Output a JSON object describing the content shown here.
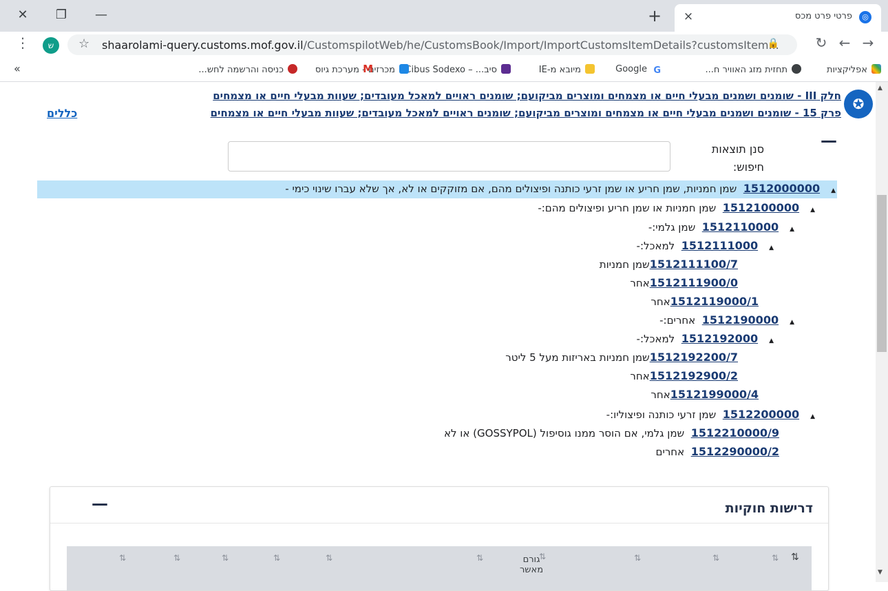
{
  "browser": {
    "tab_title": "פרטי פרט מכס",
    "tab_close": "×",
    "new_tab": "+",
    "window_close": "✕",
    "window_restore": "❐",
    "window_minimize": "—",
    "url_host": "shaarolami-query.customs.mof.gov.il",
    "url_path": "/CustomspilotWeb/he/CustomsBook/Import/ImportCustomsItemDetails?customsItem...",
    "avatar_letter": "ש",
    "bookmarks": [
      "אפליקציות",
      "תחזית מזג האוויר ח...",
      "Google",
      "מיובא מ-IE",
      "סיב... – Cibus Sodexo",
      "מכרזים - מערכת גיוס",
      "כניסה והרשמה לחש..."
    ],
    "bookmarks_overflow": "»"
  },
  "page": {
    "breadcrumb_1": "חלק III - שומנים ושמנים מבעלי חיים או מצמחים ומוצרים מביקועם; שומנים ראויים למאכל מעובדים; שעוות מבעלי חיים או מצמחים",
    "breadcrumb_2": "פרק 15 - שומנים ושמנים מבעלי חיים או מצמחים ומוצרים מביקועם; שומנים ראויים למאכל מעובדים; שעוות מבעלי חיים או מצמחים",
    "rules_link": "כללים",
    "filter_label": "סנן תוצאות חיפוש:",
    "collapse": "—",
    "tree": [
      {
        "code": "1512000000",
        "desc": "שמן חמניות, שמן חריע או שמן זרעי כותנה ופיצולים מהם, אם מזוקקים או לא, אך שלא עברו שינוי כימי -"
      },
      {
        "code": "1512100000",
        "desc": "שמן חמניות או שמן חריע ופיצולים מהם:-"
      },
      {
        "code": "1512110000",
        "desc": "שמן גלמי:-"
      },
      {
        "code": "1512111000",
        "desc": "למאכל:-"
      },
      {
        "code": "1512111100/7",
        "desc": "שמן חמניות"
      },
      {
        "code": "1512111900/0",
        "desc": "אחר"
      },
      {
        "code": "1512119000/1",
        "desc": "אחר"
      },
      {
        "code": "1512190000",
        "desc": "אחרים:-"
      },
      {
        "code": "1512192000",
        "desc": "למאכל:-"
      },
      {
        "code": "1512192200/7",
        "desc": "שמן חמניות באריזות מעל 5 ליטר"
      },
      {
        "code": "1512192900/2",
        "desc": "אחר"
      },
      {
        "code": "1512199000/4",
        "desc": "אחר"
      },
      {
        "code": "1512200000",
        "desc": "שמן זרעי כותנה ופיצוליו:-"
      },
      {
        "code": "1512210000/9",
        "desc": "שמן גלמי, אם הוסר ממנו גוסיפול (GOSSYPOL) או לא"
      },
      {
        "code": "1512290000/2",
        "desc": "אחרים"
      }
    ],
    "section_title": "דרישות חוקיות",
    "table_col": "גורם מאשר",
    "sort_icon": "⇅"
  }
}
